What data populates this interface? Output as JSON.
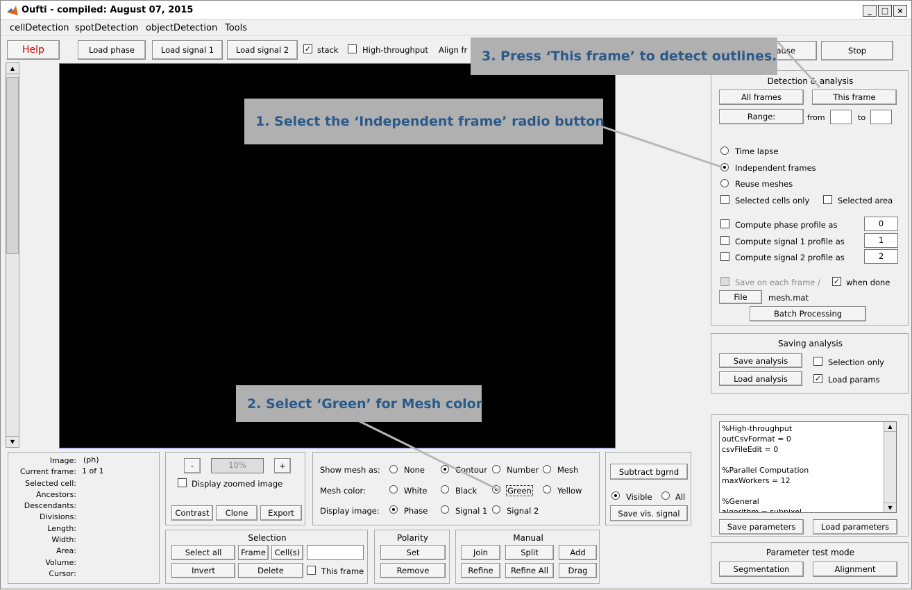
{
  "window": {
    "title": "Oufti - compiled:  August 07, 2015",
    "min": "_",
    "max": "□",
    "close": "×"
  },
  "menu": [
    "cellDetection",
    "spotDetection",
    "objectDetection",
    "Tools"
  ],
  "toolbar": {
    "help": "Help",
    "load_phase": "Load phase",
    "load_signal1": "Load signal 1",
    "load_signal2": "Load signal 2",
    "stack": "stack",
    "high_throughput": "High-throughput",
    "align": "Align fr",
    "pause": "Pause",
    "stop": "Stop"
  },
  "image_placeholder": "",
  "detection": {
    "title": "Detection & analysis",
    "all_frames": "All frames",
    "this_frame": "This frame",
    "range": "Range:",
    "from": "from",
    "to": "to",
    "time_lapse": "Time lapse",
    "independent": "Independent frames",
    "reuse": "Reuse meshes",
    "selected_cells": "Selected cells only",
    "selected_area": "Selected area",
    "phase_profile": "Compute phase profile as",
    "phase_val": "0",
    "sig1_profile": "Compute signal 1 profile as",
    "sig1_val": "1",
    "sig2_profile": "Compute signal 2 profile as",
    "sig2_val": "2",
    "save_each": "Save on each frame /",
    "when_done": "when done",
    "file": "File",
    "file_name": "mesh.mat",
    "batch": "Batch Processing"
  },
  "saving": {
    "title": "Saving analysis",
    "save": "Save analysis",
    "selection_only": "Selection only",
    "load": "Load analysis",
    "load_params": "Load params"
  },
  "params_text": [
    "%High-throughput",
    "outCsvFormat = 0",
    "csvFileEdit = 0",
    "",
    "%Parallel Computation",
    "maxWorkers = 12",
    "",
    "%General",
    "algorithm = subpixel"
  ],
  "params": {
    "save": "Save parameters",
    "load": "Load parameters"
  },
  "test_mode": {
    "title": "Parameter test mode",
    "segmentation": "Segmentation",
    "alignment": "Alignment"
  },
  "info": {
    "image": "Image:",
    "image_val": "(ph)",
    "current_frame": "Current frame:",
    "frame_val": "1 of 1",
    "selected_cell": "Selected cell:",
    "ancestors": "Ancestors:",
    "descendants": "Descendants:",
    "divisions": "Divisions:",
    "length": "Length:",
    "width": "Width:",
    "area": "Area:",
    "volume": "Volume:",
    "cursor": "Cursor:"
  },
  "zoom": {
    "minus": "-",
    "value": "10%",
    "plus": "+",
    "display_zoomed": "Display zoomed image",
    "contrast": "Contrast",
    "clone": "Clone",
    "export": "Export"
  },
  "display": {
    "show_mesh": "Show mesh as:",
    "none": "None",
    "contour": "Contour",
    "number": "Number",
    "mesh": "Mesh",
    "mesh_color": "Mesh color:",
    "white": "White",
    "black": "Black",
    "green": "Green",
    "yellow": "Yellow",
    "display_image": "Display image:",
    "phase": "Phase",
    "signal1": "Signal 1",
    "signal2": "Signal 2"
  },
  "bg": {
    "subtract": "Subtract bgrnd",
    "visible": "Visible",
    "all": "All",
    "save_vis": "Save vis. signal"
  },
  "selection": {
    "title": "Selection",
    "select_all": "Select all",
    "frame": "Frame",
    "cells": "Cell(s)",
    "invert": "Invert",
    "delete": "Delete",
    "this_frame": "This frame"
  },
  "polarity": {
    "title": "Polarity",
    "set": "Set",
    "remove": "Remove"
  },
  "manual": {
    "title": "Manual",
    "join": "Join",
    "split": "Split",
    "add": "Add",
    "refine": "Refine",
    "refine_all": "Refine All",
    "drag": "Drag"
  },
  "callouts": {
    "c1": "1.  Select the ‘Independent frame’ radio button",
    "c2": "2.  Select ‘Green’ for Mesh color",
    "c3": "3.  Press ‘This frame’ to detect outlines."
  },
  "colors": {
    "callout_bg": "#b0b0b0",
    "callout_text": "#2a5a8a",
    "help_text": "#cc0000"
  }
}
